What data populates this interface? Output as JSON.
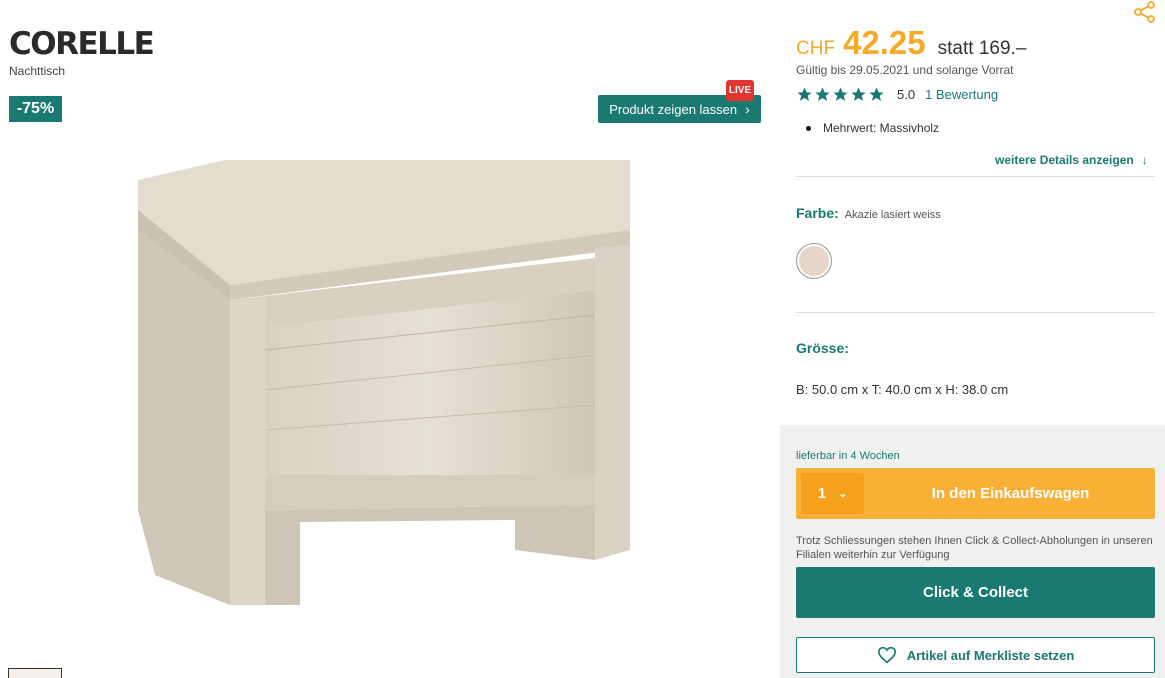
{
  "product": {
    "brand": "CORELLE",
    "subtitle": "Nachttisch",
    "discount_badge": "-75%",
    "live_button": "Produkt zeigen lassen",
    "live_badge": "LIVE"
  },
  "price": {
    "currency": "CHF",
    "amount": "42.25",
    "old_price": "statt 169.–",
    "validity": "Gültig bis 29.05.2021 und solange Vorrat"
  },
  "rating": {
    "value": "5.0",
    "stars": 5,
    "reviews_link": "1 Bewertung"
  },
  "features": {
    "bullet": "Mehrwert: Massivholz",
    "more_details": "weitere Details anzeigen"
  },
  "color": {
    "label": "Farbe:",
    "value": "Akazie lasiert weiss",
    "swatch": "#e6d5c8"
  },
  "size": {
    "label": "Grösse:",
    "dimensions": "B: 50.0 cm x T: 40.0 cm x H: 38.0 cm"
  },
  "buy": {
    "delivery": "lieferbar in 4 Wochen",
    "quantity": "1",
    "cart_label": "In den Einkaufswagen",
    "notice": "Trotz Schliessungen stehen Ihnen Click & Collect-Abholungen in unseren Filialen weiterhin zur Verfügung",
    "click_collect": "Click & Collect",
    "wishlist": "Artikel auf Merkliste setzen"
  },
  "colors": {
    "accent": "#1a7a72",
    "price": "#f7a928",
    "cart": "#f8b136",
    "live": "#e4342f"
  }
}
